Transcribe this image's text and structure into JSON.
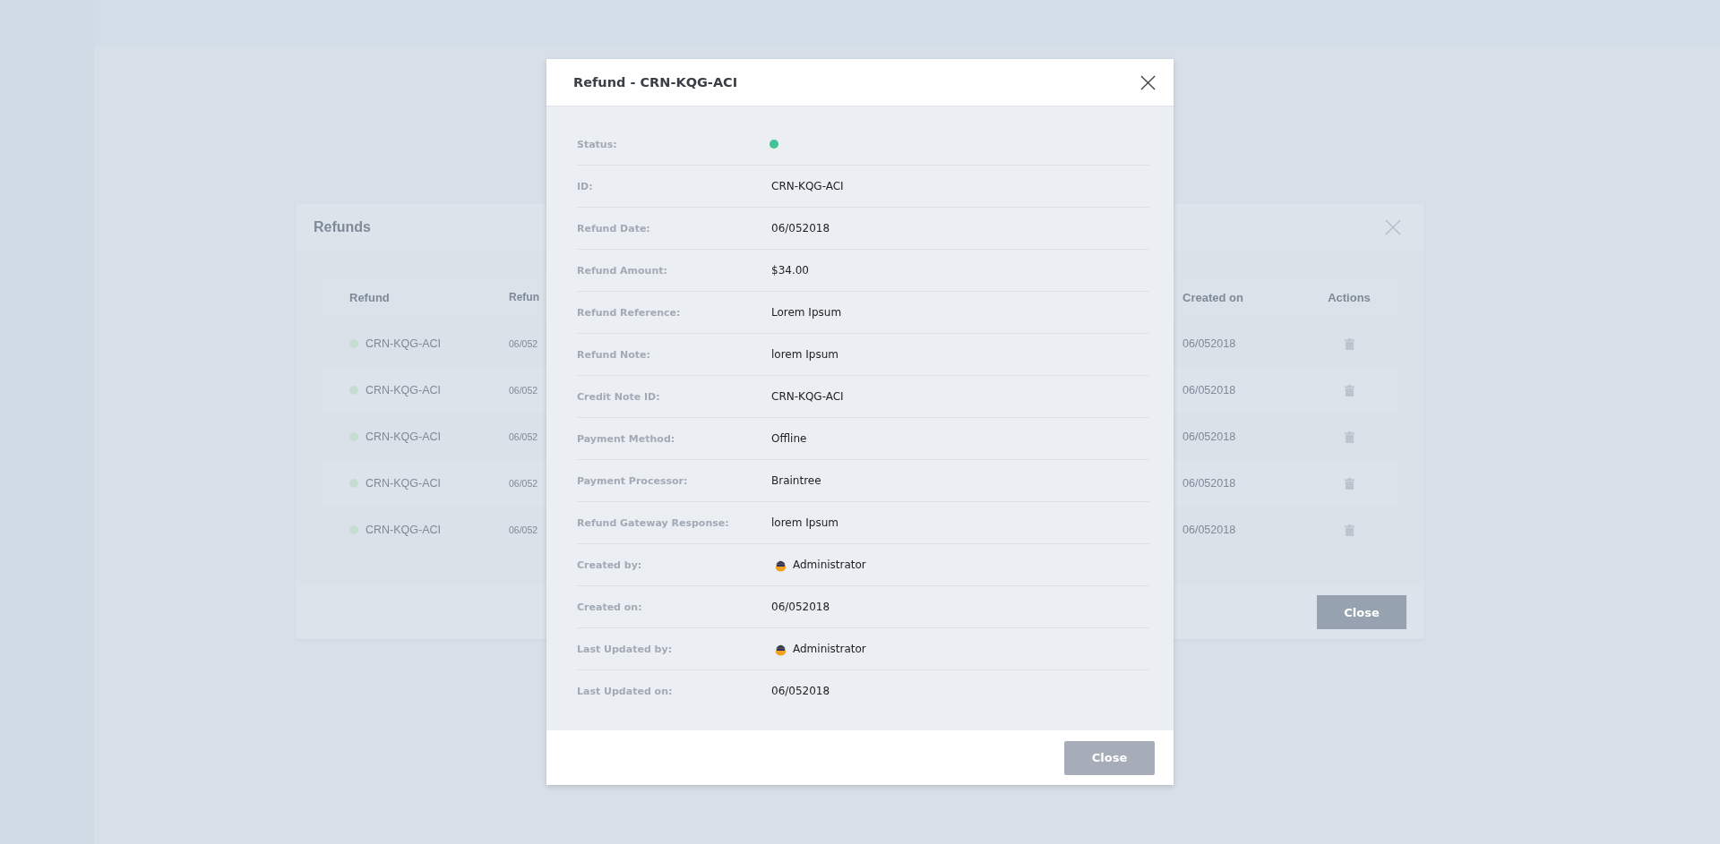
{
  "background_modal": {
    "title": "Refunds",
    "columns": [
      "Refund",
      "Refun",
      "Created on",
      "Actions"
    ],
    "rows": [
      {
        "refund": "CRN-KQG-ACI",
        "column_2": "06/052",
        "created_on": "06/052018",
        "color": "#c6dcd3"
      },
      {
        "refund": "CRN-KQG-ACI",
        "column_2": "06/052",
        "created_on": "06/052018",
        "color": "#c6dcd3"
      },
      {
        "refund": "CRN-KQG-ACI",
        "column_2": "06/052",
        "created_on": "06/052018",
        "color": "#c6dcd3"
      },
      {
        "refund": "CRN-KQG-ACI",
        "column_2": "06/052",
        "created_on": "06/052018",
        "color": "#c6dcd3"
      },
      {
        "refund": "CRN-KQG-ACI",
        "column_2": "06/052",
        "created_on": "06/052018",
        "color": "#c6dcd3"
      }
    ],
    "close_button": "Close"
  },
  "dialog": {
    "title": "Refund - CRN-KQG-ACI",
    "fields": [
      {
        "kind": "status",
        "label": "Status:",
        "color": "#41c393"
      },
      {
        "kind": "text",
        "label": "ID:",
        "value": "CRN-KQG-ACI"
      },
      {
        "kind": "text",
        "label": "Refund Date:",
        "value": "06/052018"
      },
      {
        "kind": "text",
        "label": "Refund Amount:",
        "value": "$34.00"
      },
      {
        "kind": "text",
        "label": "Refund Reference:",
        "value": "Lorem Ipsum"
      },
      {
        "kind": "text",
        "label": "Refund Note:",
        "value": "lorem Ipsum"
      },
      {
        "kind": "text",
        "label": "Credit Note ID:",
        "value": "CRN-KQG-ACI"
      },
      {
        "kind": "text",
        "label": "Payment Method:",
        "value": "Offline"
      },
      {
        "kind": "text",
        "label": "Payment Processor:",
        "value": "Braintree"
      },
      {
        "kind": "text",
        "label": "Refund Gateway Response:",
        "value": "lorem Ipsum"
      },
      {
        "kind": "user",
        "label": "Created by:",
        "value": "Administrator"
      },
      {
        "kind": "text",
        "label": "Created on:",
        "value": "06/052018"
      },
      {
        "kind": "user",
        "label": "Last Updated by:",
        "value": "Administrator"
      },
      {
        "kind": "text",
        "label": "Last Updated on:",
        "value": "06/052018"
      }
    ],
    "close_button": "Close"
  }
}
